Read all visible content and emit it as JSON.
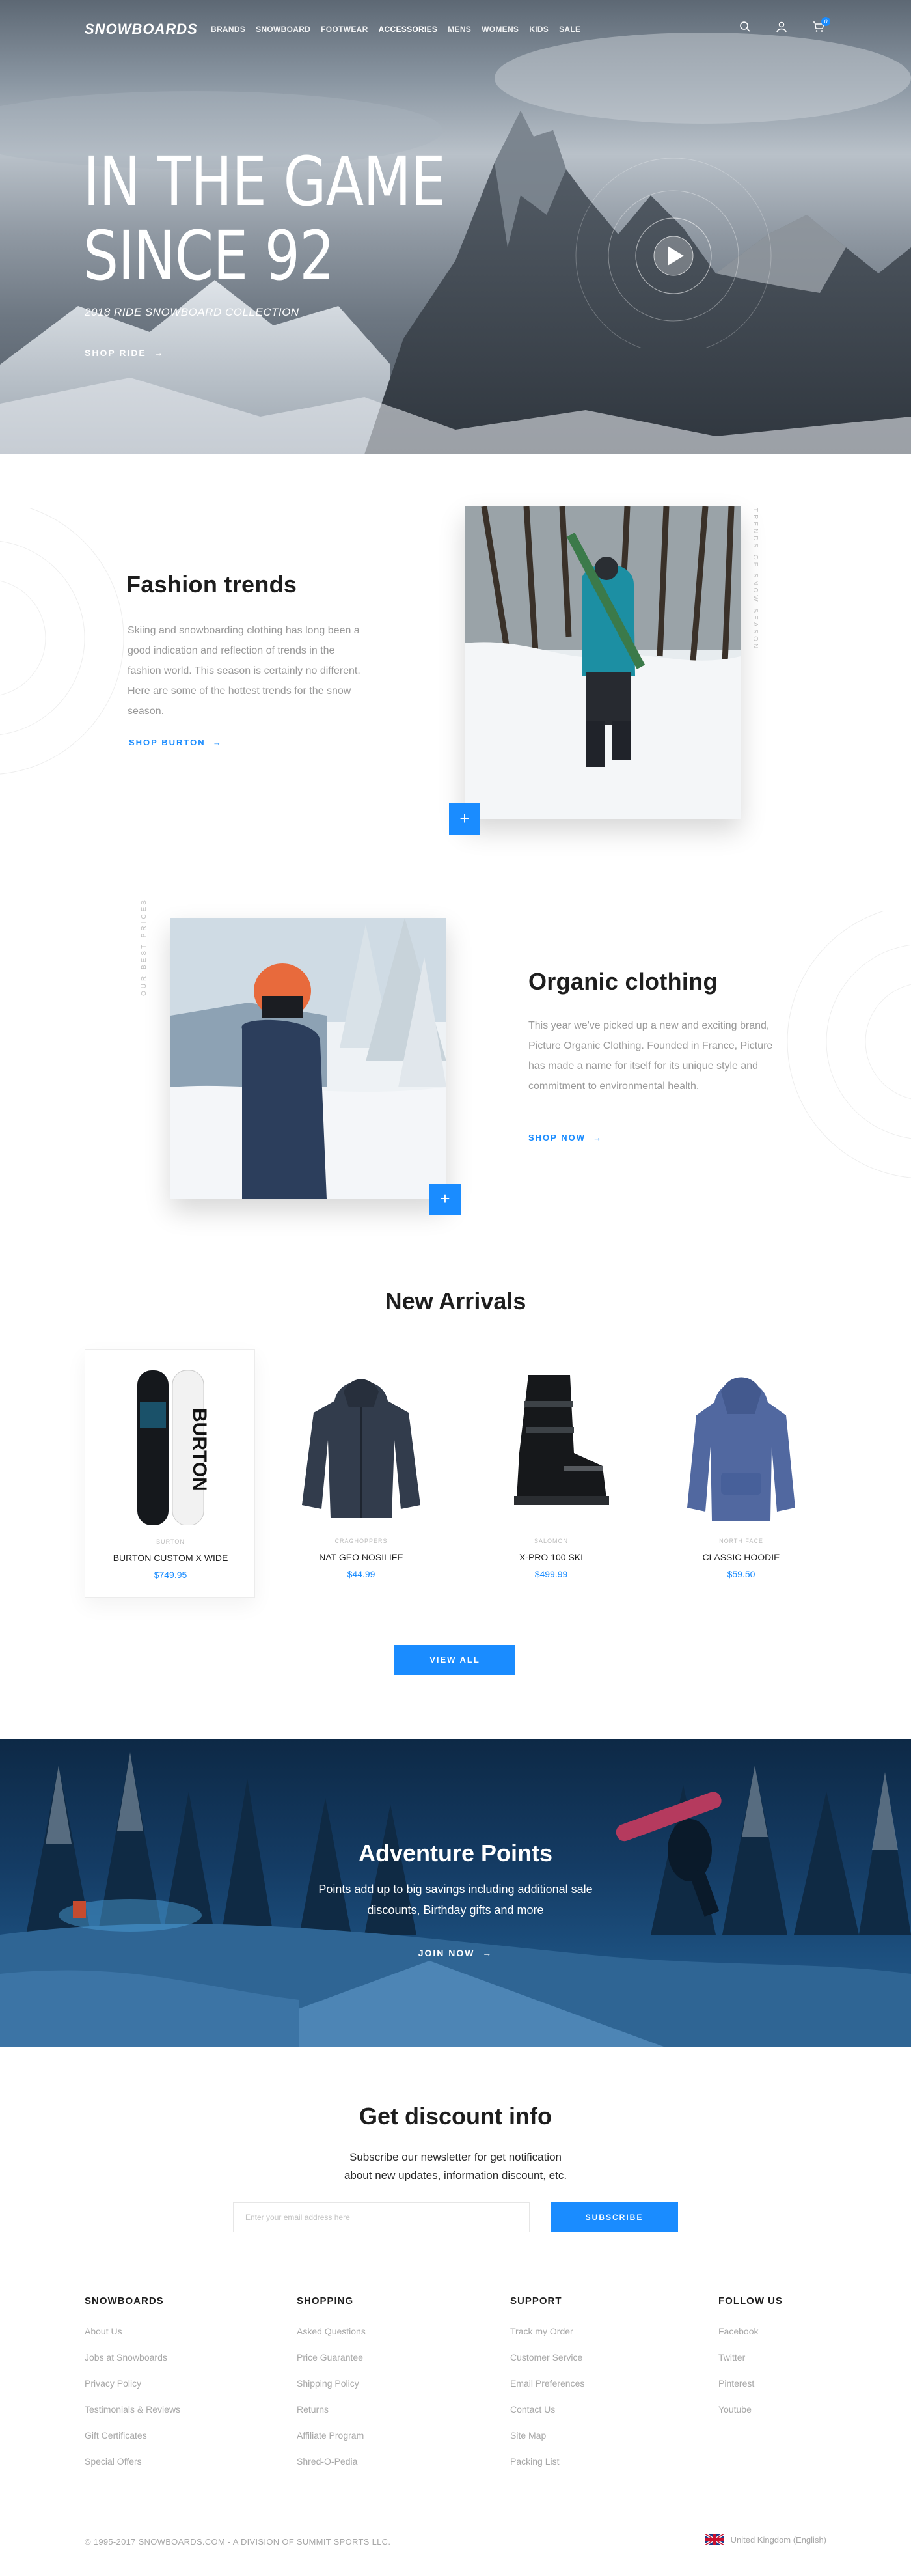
{
  "nav": {
    "logo": "SNOWBOARDS",
    "items": [
      "BRANDS",
      "SNOWBOARD",
      "FOOTWEAR",
      "ACCESSORIES",
      "MENS",
      "WOMENS",
      "KIDS",
      "SALE"
    ],
    "cart_count": "0"
  },
  "hero": {
    "title_line1": "IN THE GAME",
    "title_line2": "SINCE 92",
    "subtitle": "2018 RIDE SNOWBOARD COLLECTION",
    "cta": "SHOP RIDE"
  },
  "fashion": {
    "title": "Fashion trends",
    "text": "Skiing and snowboarding clothing has long been a good indication and reflection of trends in the fashion world.  This season is certainly no different.  Here are some of the hottest trends for the snow season.",
    "link": "SHOP BURTON",
    "vertical_label": "TRENDS OF SNOW SEASON"
  },
  "organic": {
    "title": "Organic clothing",
    "text": "This year we've picked up a new and exciting brand, Picture Organic Clothing. Founded in France, Picture has made a name for itself for its unique style and commitment to environmental health.",
    "link": "SHOP NOW",
    "vertical_label": "OUR BEST PRICES"
  },
  "arrivals": {
    "title": "New Arrivals",
    "products": [
      {
        "brand": "BURTON",
        "name": "BURTON CUSTOM X WIDE",
        "price": "$749.95"
      },
      {
        "brand": "CRAGHOPPERS",
        "name": "NAT GEO NOSILIFE",
        "price": "$44.99"
      },
      {
        "brand": "SALOMON",
        "name": "X-PRO 100 SKI",
        "price": "$499.99"
      },
      {
        "brand": "NORTH FACE",
        "name": "CLASSIC HOODIE",
        "price": "$59.50"
      }
    ],
    "view_all": "VIEW ALL"
  },
  "adventure": {
    "title": "Adventure Points",
    "text_line1": "Points add up to big savings including additional sale",
    "text_line2": "discounts, Birthday gifts and more",
    "cta": "JOIN NOW"
  },
  "newsletter": {
    "title": "Get discount info",
    "text_line1": "Subscribe our newsletter for get notification",
    "text_line2": "about new updates, information discount, etc.",
    "placeholder": "Enter your email address here",
    "button": "SUBSCRIBE"
  },
  "footer": {
    "columns": [
      {
        "title": "SNOWBOARDS",
        "links": [
          "About Us",
          "Jobs at Snowboards",
          "Privacy Policy",
          "Testimonials & Reviews",
          "Gift Certificates",
          "Special Offers"
        ]
      },
      {
        "title": "SHOPPING",
        "links": [
          "Asked Questions",
          "Price Guarantee",
          "Shipping Policy",
          "Returns",
          "Affiliate Program",
          "Shred-O-Pedia"
        ]
      },
      {
        "title": "SUPPORT",
        "links": [
          "Track my Order",
          "Customer Service",
          "Email Preferences",
          "Contact Us",
          "Site Map",
          "Packing List"
        ]
      },
      {
        "title": "FOLLOW US",
        "links": [
          "Facebook",
          "Twitter",
          "Pinterest",
          "Youtube"
        ]
      }
    ],
    "copyright": "© 1995-2017 SNOWBOARDS.COM - A DIVISION OF SUMMIT SPORTS LLC.",
    "language": "United Kingdom (English)"
  },
  "colors": {
    "accent": "#1a8cff",
    "heading": "#1e1e1e",
    "muted": "#9a9a9a"
  }
}
